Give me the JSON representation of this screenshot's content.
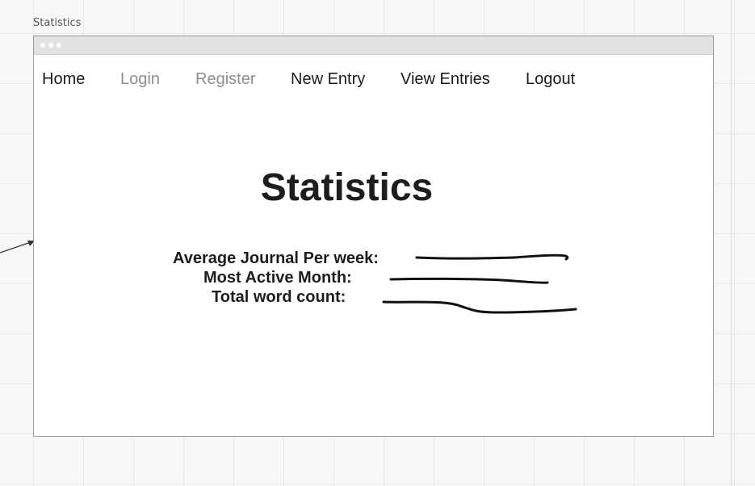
{
  "frame": {
    "label": "Statistics"
  },
  "window": {
    "titlebar_dots": [
      "dot",
      "dot",
      "dot"
    ]
  },
  "nav": {
    "items": [
      {
        "label": "Home",
        "state": "active"
      },
      {
        "label": "Login",
        "state": "muted"
      },
      {
        "label": "Register",
        "state": "muted"
      },
      {
        "label": "New Entry",
        "state": "active"
      },
      {
        "label": "View Entries",
        "state": "active"
      },
      {
        "label": "Logout",
        "state": "active"
      }
    ]
  },
  "page": {
    "title": "Statistics"
  },
  "stats": {
    "rows": [
      {
        "label": "Average Journal Per week:",
        "value": ""
      },
      {
        "label": "Most Active Month:",
        "value": ""
      },
      {
        "label": "Total word count:",
        "value": ""
      }
    ]
  },
  "colors": {
    "nav_active": "#1b1b1b",
    "nav_muted": "#8e8e8e",
    "scribble": "#111111"
  },
  "icons": {
    "connector": "arrow-icon"
  }
}
